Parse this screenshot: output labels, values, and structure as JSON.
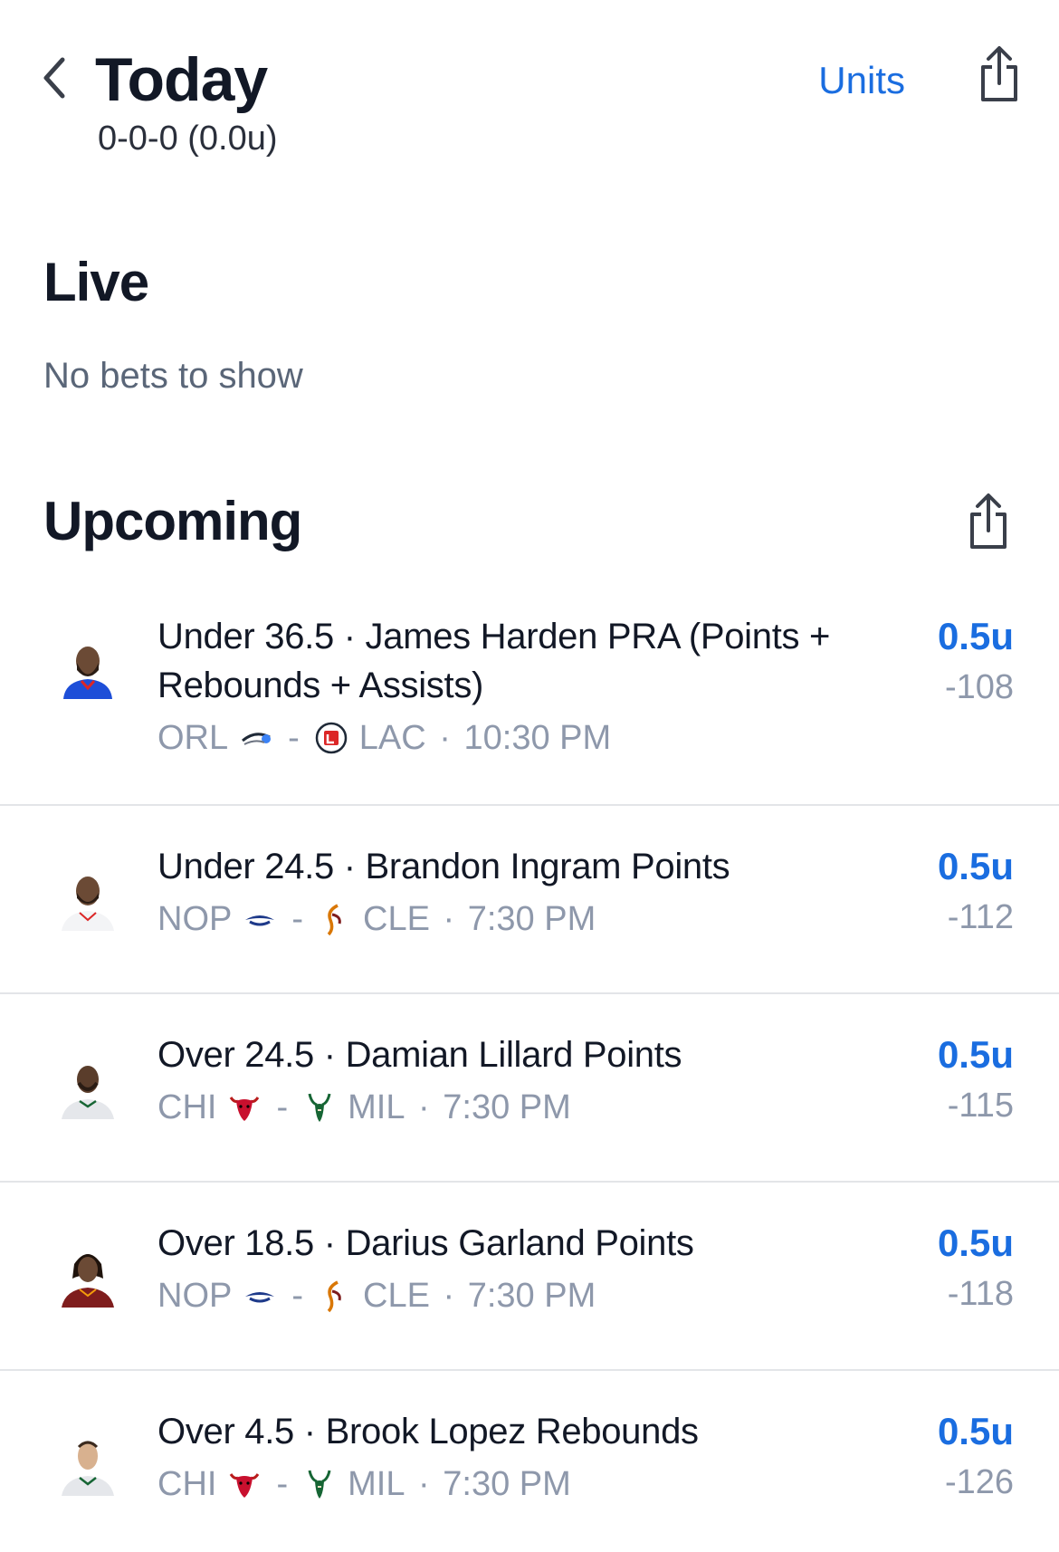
{
  "header": {
    "title": "Today",
    "record": "0-0-0 (0.0u)",
    "units_label": "Units"
  },
  "live": {
    "title": "Live",
    "empty_text": "No bets to show"
  },
  "upcoming": {
    "title": "Upcoming",
    "bets": [
      {
        "title": "Under 36.5 · James Harden PRA (Points + Rebounds + Assists)",
        "away": "ORL",
        "home": "LAC",
        "time": "10:30 PM",
        "stake": "0.5u",
        "odds": "-108",
        "away_icon": "magic-logo-icon",
        "home_icon": "clippers-logo-icon"
      },
      {
        "title": "Under 24.5 · Brandon Ingram Points",
        "away": "NOP",
        "home": "CLE",
        "time": "7:30 PM",
        "stake": "0.5u",
        "odds": "-112",
        "away_icon": "pelicans-logo-icon",
        "home_icon": "cavaliers-logo-icon"
      },
      {
        "title": "Over 24.5 · Damian Lillard Points",
        "away": "CHI",
        "home": "MIL",
        "time": "7:30 PM",
        "stake": "0.5u",
        "odds": "-115",
        "away_icon": "bulls-logo-icon",
        "home_icon": "bucks-logo-icon"
      },
      {
        "title": "Over 18.5 · Darius Garland Points",
        "away": "NOP",
        "home": "CLE",
        "time": "7:30 PM",
        "stake": "0.5u",
        "odds": "-118",
        "away_icon": "pelicans-logo-icon",
        "home_icon": "cavaliers-logo-icon"
      },
      {
        "title": "Over 4.5 · Brook Lopez Rebounds",
        "away": "CHI",
        "home": "MIL",
        "time": "7:30 PM",
        "stake": "0.5u",
        "odds": "-126",
        "away_icon": "bulls-logo-icon",
        "home_icon": "bucks-logo-icon"
      }
    ]
  },
  "colors": {
    "accent": "#1a6de0",
    "muted": "#8e98ab",
    "text": "#121826"
  }
}
